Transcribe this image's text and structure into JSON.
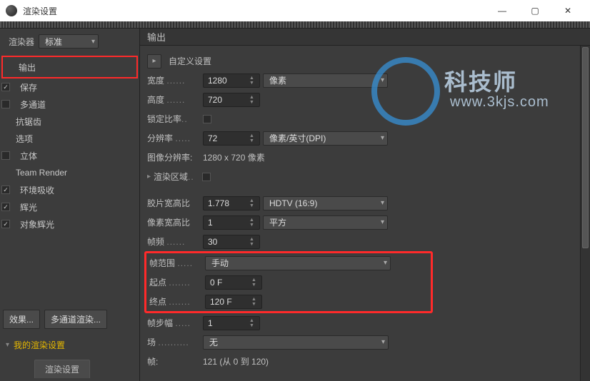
{
  "window": {
    "title": "渲染设置",
    "min": "—",
    "max": "▢",
    "close": "✕"
  },
  "sidebar": {
    "renderer_label": "渲染器",
    "renderer_value": "标准",
    "items": [
      {
        "label": "输出",
        "checked": null
      },
      {
        "label": "保存",
        "checked": true
      },
      {
        "label": "多通道",
        "checked": false
      },
      {
        "label": "抗锯齿",
        "checked": null
      },
      {
        "label": "选项",
        "checked": null
      },
      {
        "label": "立体",
        "checked": false
      },
      {
        "label": "Team Render",
        "checked": null
      },
      {
        "label": "环境吸收",
        "checked": true
      },
      {
        "label": "辉光",
        "checked": true
      },
      {
        "label": "对象辉光",
        "checked": true
      }
    ],
    "effects_btn": "效果...",
    "multipass_btn": "多通道渲染...",
    "preset_label": "我的渲染设置",
    "bottom_tab": "渲染设置"
  },
  "content": {
    "header": "输出",
    "custom_preset": "自定义设置",
    "width_label": "宽度",
    "width_value": "1280",
    "width_unit": "像素",
    "height_label": "高度",
    "height_value": "720",
    "lock_ratio_label": "锁定比率",
    "resolution_label": "分辨率",
    "resolution_value": "72",
    "resolution_unit": "像素/英寸(DPI)",
    "image_res_label": "图像分辨率:",
    "image_res_value": "1280 x 720 像素",
    "render_region_label": "渲染区域",
    "film_aspect_label": "胶片宽高比",
    "film_aspect_value": "1.778",
    "film_aspect_preset": "HDTV (16:9)",
    "pixel_aspect_label": "像素宽高比",
    "pixel_aspect_value": "1",
    "pixel_aspect_preset": "平方",
    "fps_label": "帧频",
    "fps_value": "30",
    "frame_range_label": "帧范围",
    "frame_range_value": "手动",
    "start_label": "起点",
    "start_value": "0 F",
    "end_label": "终点",
    "end_value": "120 F",
    "step_label": "帧步幅",
    "step_value": "1",
    "field_label": "场",
    "field_value": "无",
    "frames_label": "帧:",
    "frames_value": "121 (从 0 到 120)"
  },
  "watermark": {
    "text1": "科技师",
    "text2": "www.3kjs.com"
  }
}
